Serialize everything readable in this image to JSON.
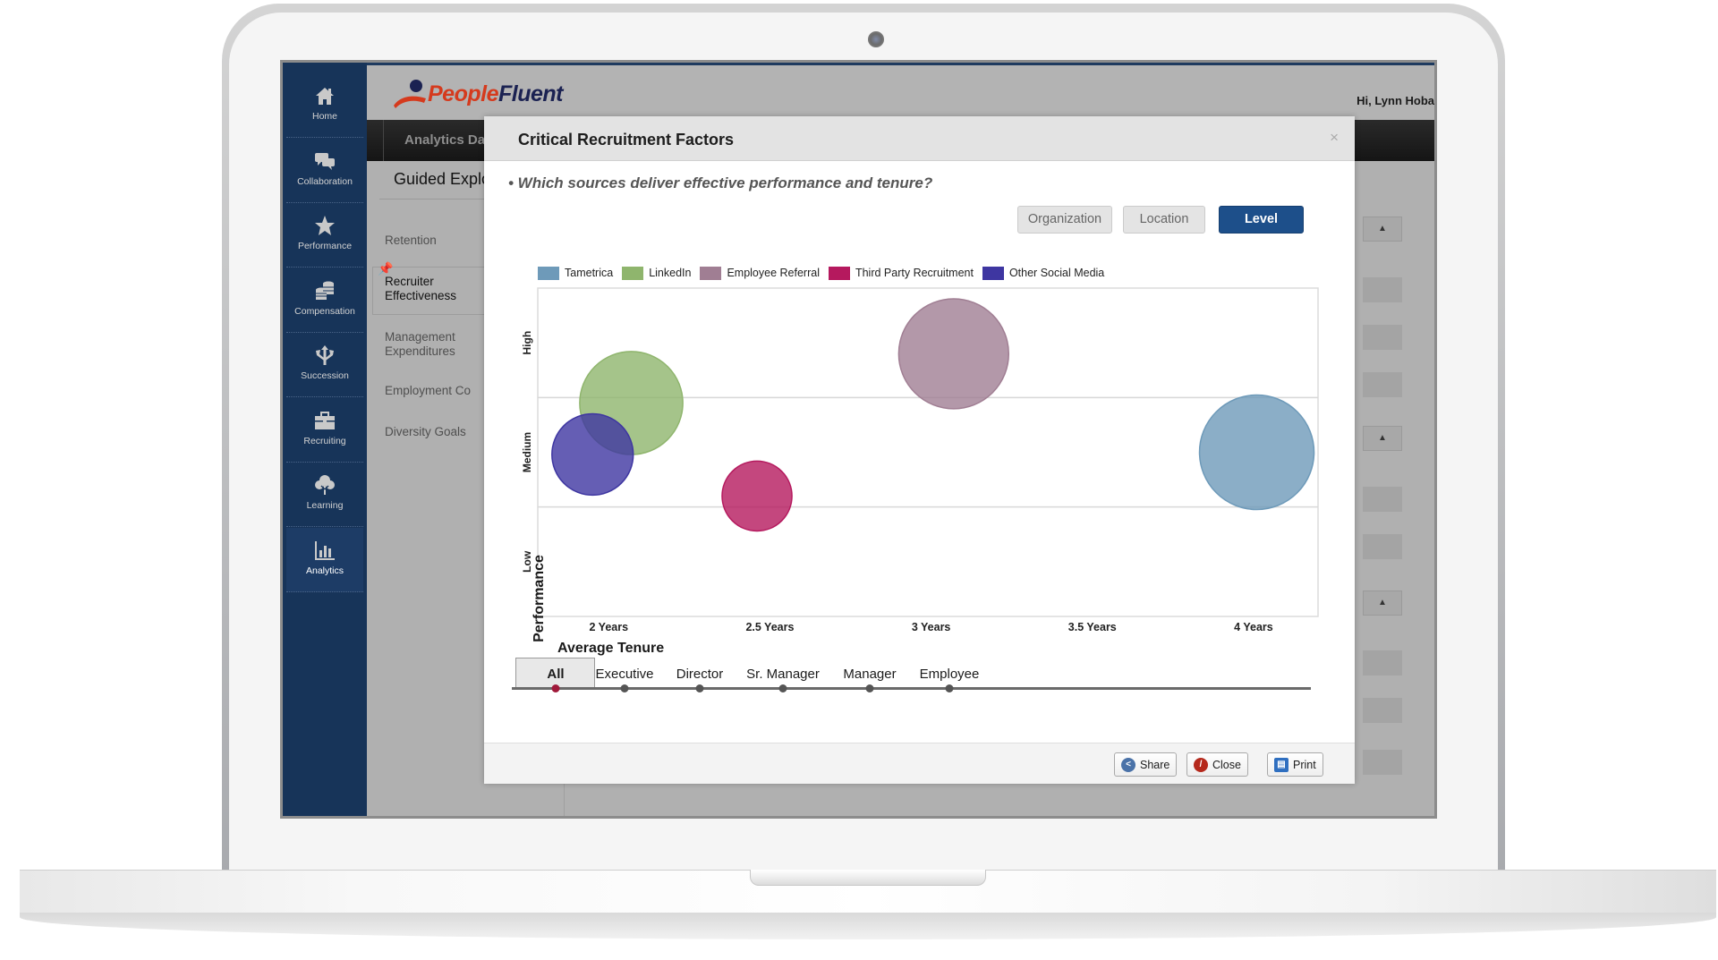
{
  "sidebar": {
    "items": [
      {
        "label": "Home",
        "icon": "home-icon"
      },
      {
        "label": "Collaboration",
        "icon": "chat-bubbles-icon"
      },
      {
        "label": "Performance",
        "icon": "star-icon"
      },
      {
        "label": "Compensation",
        "icon": "coins-icon"
      },
      {
        "label": "Succession",
        "icon": "split-arrows-icon"
      },
      {
        "label": "Recruiting",
        "icon": "briefcase-icon"
      },
      {
        "label": "Learning",
        "icon": "tree-icon"
      },
      {
        "label": "Analytics",
        "icon": "bar-chart-icon",
        "active": true
      }
    ]
  },
  "header": {
    "logo_part1": "People",
    "logo_part2": "Fluent",
    "greeting": "Hi, Lynn Hoba"
  },
  "tabbar": {
    "tab_label": "Analytics Da"
  },
  "page": {
    "subtitle": "Guided Explo",
    "side_links": [
      {
        "label": "Retention"
      },
      {
        "label": "Recruiter\nEffectiveness",
        "line1": "Recruiter",
        "line2": "Effectiveness",
        "active": true
      },
      {
        "label": "Management Expenditures",
        "line1": "Management",
        "line2": "Expenditures"
      },
      {
        "label": "Employment Co"
      },
      {
        "label": "Diversity Goals"
      }
    ],
    "collapse_glyph": "▲"
  },
  "modal": {
    "title": "Critical Recruitment Factors",
    "close_glyph": "×",
    "question": "• Which sources deliver effective performance and tenure?",
    "view_buttons": [
      {
        "label": "Organization",
        "active": false
      },
      {
        "label": "Location",
        "active": false
      },
      {
        "label": "Level",
        "active": true
      }
    ],
    "levels": [
      {
        "label": "All",
        "active": true
      },
      {
        "label": "Executive",
        "active": false
      },
      {
        "label": "Director",
        "active": false
      },
      {
        "label": "Sr. Manager",
        "active": false
      },
      {
        "label": "Manager",
        "active": false
      },
      {
        "label": "Employee",
        "active": false
      }
    ],
    "footer_buttons": [
      {
        "label": "Share",
        "icon": "share-icon",
        "color": "#4a72a8"
      },
      {
        "label": "Close",
        "icon": "close-circle-icon",
        "color": "#b5291c"
      },
      {
        "label": "Print",
        "icon": "printer-icon",
        "color": "#2f6fc0"
      }
    ]
  },
  "chart_data": {
    "type": "bubble",
    "title": "Critical Recruitment Factors",
    "xlabel": "Average Tenure",
    "ylabel": "Performance",
    "x_ticks": [
      {
        "value": 2.0,
        "label": "2 Years"
      },
      {
        "value": 2.5,
        "label": "2.5 Years"
      },
      {
        "value": 3.0,
        "label": "3 Years"
      },
      {
        "value": 3.5,
        "label": "3.5 Years"
      },
      {
        "value": 4.0,
        "label": "4 Years"
      }
    ],
    "xlim": [
      1.78,
      4.2
    ],
    "y_bands": [
      "Low",
      "Medium",
      "High"
    ],
    "ylim": [
      0,
      3
    ],
    "grid": true,
    "legend_position": "top-left",
    "series": [
      {
        "name": "Tametrica",
        "color": "#6e9ab9",
        "x": 4.01,
        "y": 1.5,
        "size": 1.0
      },
      {
        "name": "LinkedIn",
        "color": "#8fb56d",
        "x": 2.07,
        "y": 1.95,
        "size": 0.9
      },
      {
        "name": "Employee Referral",
        "color": "#a07e93",
        "x": 3.07,
        "y": 2.4,
        "size": 0.96
      },
      {
        "name": "Third Party Recruitment",
        "color": "#b5195e",
        "x": 2.46,
        "y": 1.1,
        "size": 0.61
      },
      {
        "name": "Other Social Media",
        "color": "#3e36a1",
        "x": 1.95,
        "y": 1.48,
        "size": 0.71
      }
    ]
  }
}
